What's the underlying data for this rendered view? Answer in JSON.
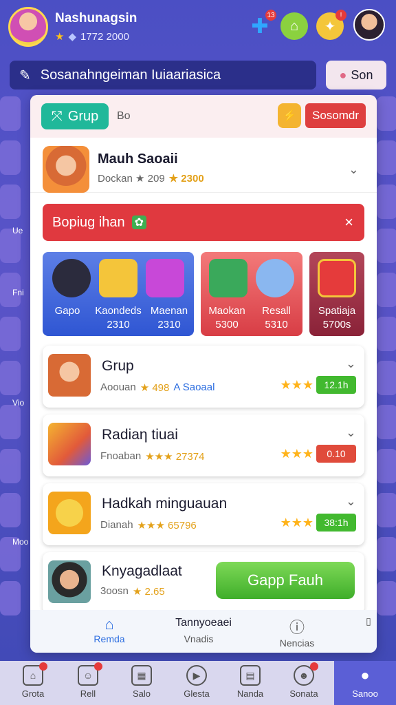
{
  "profile": {
    "username": "Nashunagsin",
    "stats": "1772 2000"
  },
  "header": {
    "notification_count": "13"
  },
  "search": {
    "text": "Sosanahngeiman Iuiaariasica",
    "sort_label": "Son"
  },
  "side_labels": [
    "Ue",
    "Fni",
    "Vio",
    "Moo"
  ],
  "panel": {
    "group_button": "Grup",
    "head_text": "Bo",
    "head_action": "Sosomdr",
    "featured": {
      "title": "Mauh Saoaii",
      "meta": "Dockan ★ 209",
      "score": "★ 2300"
    },
    "alert": {
      "text": "Bopiug ihan",
      "close": "×"
    },
    "cards": [
      {
        "label": "Gapo",
        "sub": ""
      },
      {
        "label": "Kaondeds",
        "sub": "2310"
      },
      {
        "label": "Maenan",
        "sub": "2310"
      },
      {
        "label": "Maokan",
        "sub": "5300"
      },
      {
        "label": "Resall",
        "sub": "5310"
      },
      {
        "label": "Spatiaja",
        "sub": "5700s"
      }
    ],
    "rows": [
      {
        "title": "Grup",
        "meta": "Aoouan",
        "score": "★ 498",
        "extra": "A Saoaal",
        "stars": "★★★",
        "pill": "12.1h",
        "pill_color": "#42b92f"
      },
      {
        "title": "Radiaη tiuai",
        "meta": "Fnoaban",
        "score": "★★★ 27374",
        "extra": "",
        "stars": "★★★",
        "pill": "0.10",
        "pill_color": "#e04b3b"
      },
      {
        "title": "Hadkah minguauan",
        "meta": "Dianah",
        "score": "★★★ 65796",
        "extra": "",
        "stars": "★★★",
        "pill": "38:1h",
        "pill_color": "#42b92f"
      },
      {
        "title": "Knyagadlaat",
        "meta": "3oosn",
        "score": "★ 2.65",
        "extra": "",
        "stars": "",
        "pill": "",
        "pill_color": ""
      }
    ],
    "play_button": "Gapp Fauh",
    "inner_nav": {
      "center": "Tannyoeaei",
      "items": [
        "Remda",
        "Vnadis",
        "Nencias"
      ]
    }
  },
  "bottom_nav": [
    "Grota",
    "Rell",
    "Salo",
    "Glesta",
    "Nanda",
    "Sonata",
    "Sanoo"
  ],
  "colors": {
    "accent": "#20b89a",
    "alert": "#e0393f",
    "primary_nav": "#5b5fd6"
  }
}
